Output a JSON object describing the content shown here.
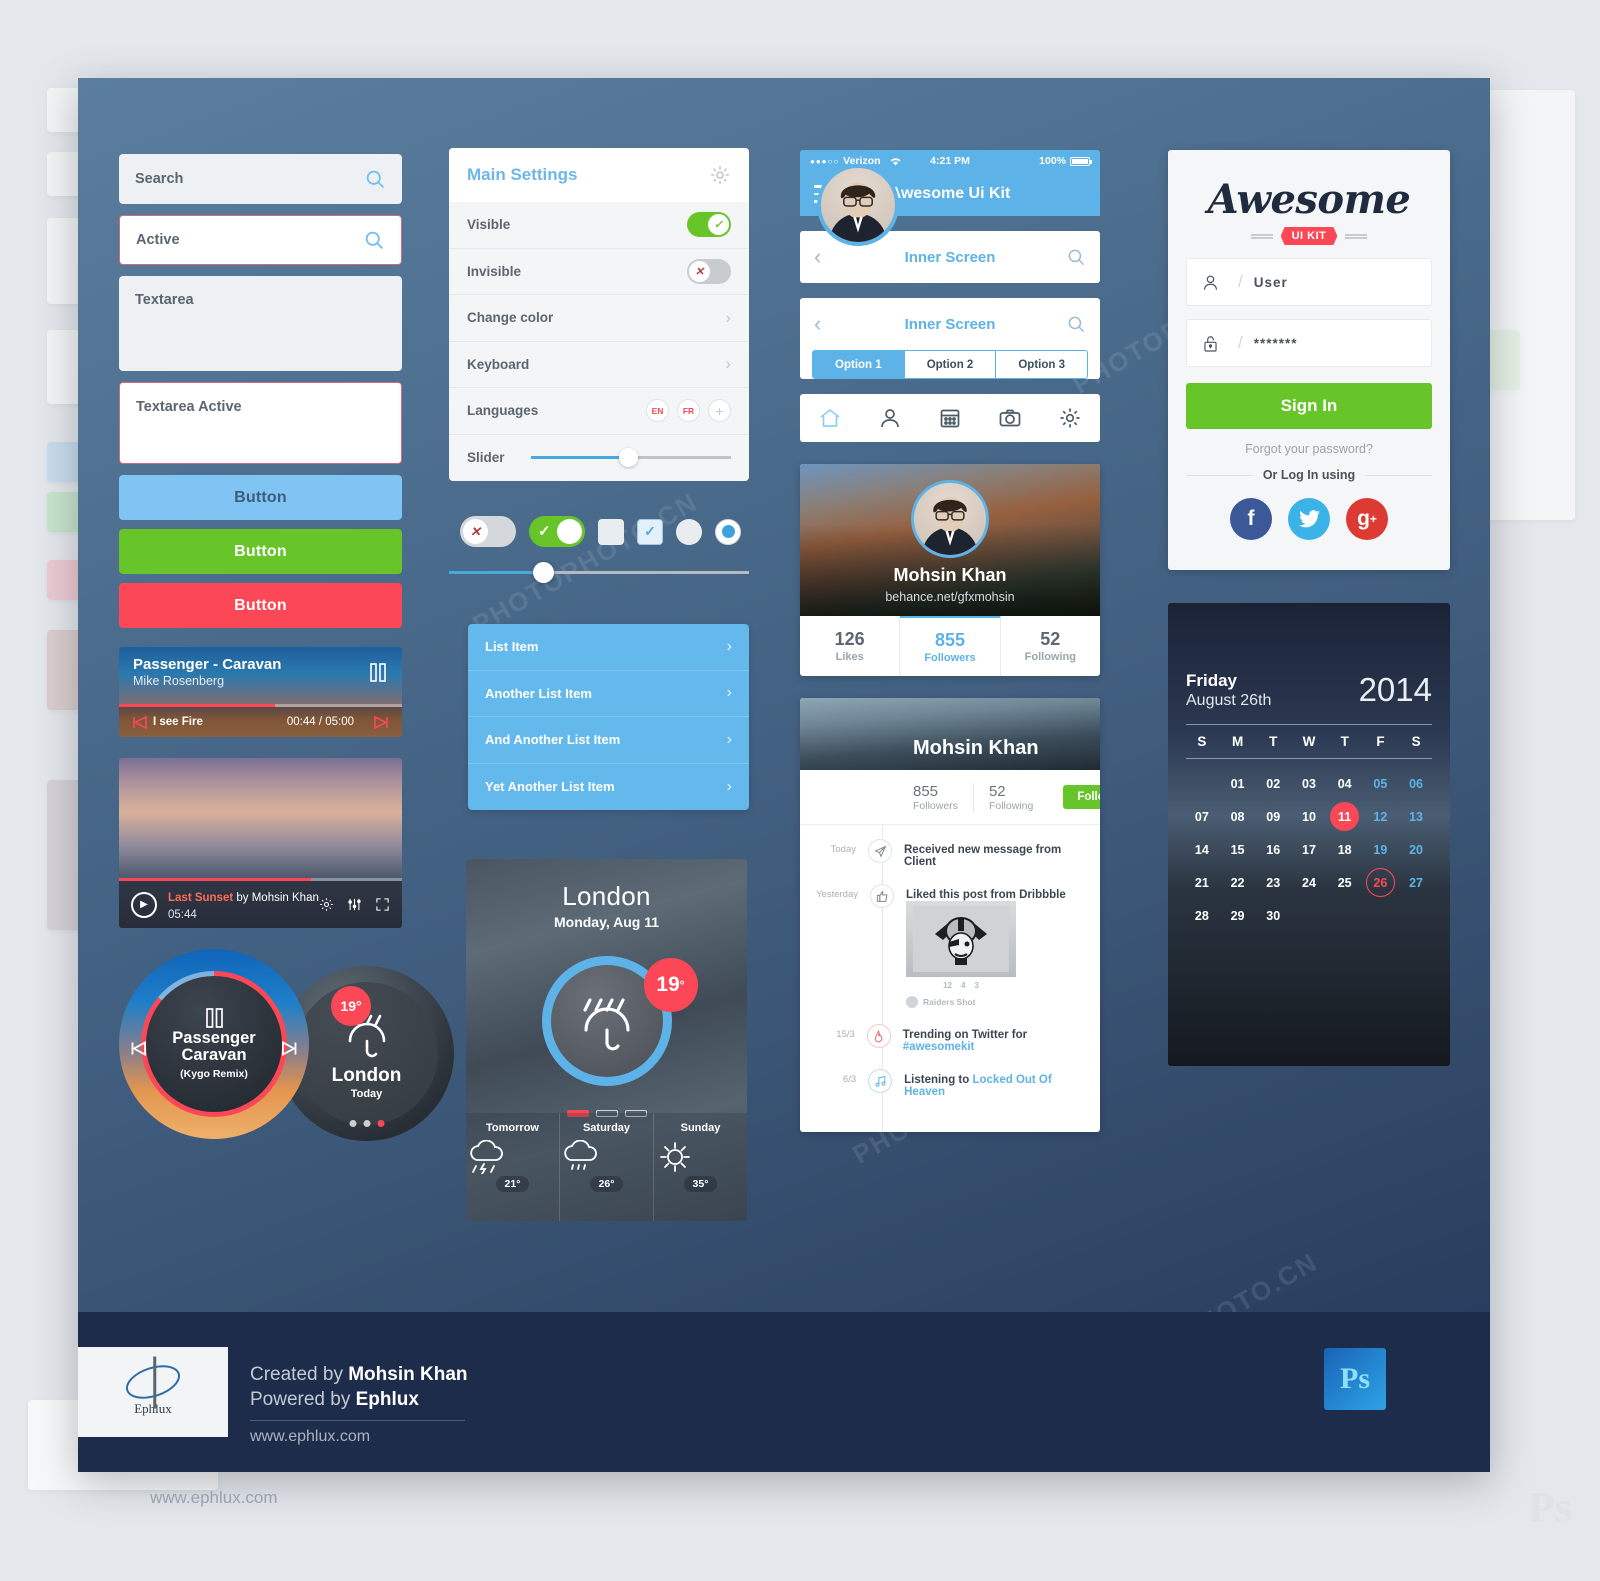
{
  "forms": {
    "search_value": "Search",
    "active_value": "Active",
    "textarea_value": "Textarea",
    "textarea_active_value": "Textarea Active",
    "button_blue": "Button",
    "button_green": "Button",
    "button_red": "Button",
    "accent_blue": "#7fc4f2",
    "accent_green": "#67c52a",
    "accent_red": "#fc4856"
  },
  "music_card": {
    "title": "Passenger - Caravan",
    "artist": "Mike Rosenberg",
    "track": "I see Fire",
    "time": "00:44 / 05:00"
  },
  "video_card": {
    "title": "Last Sunset",
    "by": "by Mohsin Khan",
    "duration": "05:44"
  },
  "circle_music": {
    "title_line1": "Passenger",
    "title_line2": "Caravan",
    "remix": "(Kygo Remix)"
  },
  "circle_weather": {
    "temp": "19°",
    "city": "London",
    "day": "Today"
  },
  "settings": {
    "title": "Main Settings",
    "rows": [
      {
        "label": "Visible",
        "control": "toggle-on"
      },
      {
        "label": "Invisible",
        "control": "toggle-off"
      },
      {
        "label": "Change color",
        "control": "chevron"
      },
      {
        "label": "Keyboard",
        "control": "chevron"
      },
      {
        "label": "Languages",
        "control": "langs"
      },
      {
        "label": "Slider",
        "control": "slider"
      }
    ],
    "lang_en": "EN",
    "lang_fr": "FR",
    "lang_add": "+"
  },
  "list": {
    "items": [
      "List Item",
      "Another List Item",
      "And Another List Item",
      "Yet Another List Item"
    ]
  },
  "weather": {
    "city": "London",
    "date": "Monday, Aug 11",
    "temp": "19",
    "degree": "°",
    "forecast": [
      {
        "day": "Tomorrow",
        "icon": "thunder-rain",
        "temp": "21°",
        "cond": "Thunder"
      },
      {
        "day": "Saturday",
        "icon": "shower",
        "temp": "26°",
        "cond": "Shower"
      },
      {
        "day": "Sunday",
        "icon": "sunny",
        "temp": "35°",
        "cond": "Sunny"
      }
    ]
  },
  "phone": {
    "carrier": "Verizon",
    "signal_dots": "●●●○○",
    "time": "4:21 PM",
    "battery": "100%",
    "app_title": "Awesome Ui Kit",
    "inner_screen_title": "Inner Screen",
    "segments": [
      "Option 1",
      "Option 2",
      "Option 3"
    ],
    "tabs": [
      "home-icon",
      "user-icon",
      "calendar-icon",
      "camera-icon",
      "gear-icon"
    ]
  },
  "profile_card": {
    "name": "Mohsin Khan",
    "url": "behance.net/gfxmohsin",
    "stats": [
      {
        "value": "126",
        "label": "Likes",
        "active": false
      },
      {
        "value": "855",
        "label": "Followers",
        "active": true
      },
      {
        "value": "52",
        "label": "Following",
        "active": false
      }
    ]
  },
  "feed_card": {
    "name": "Mohsin Khan",
    "followers_value": "855",
    "followers_label": "Followers",
    "following_value": "52",
    "following_label": "Following",
    "follow_button": "Follow",
    "events": [
      {
        "when": "Today",
        "icon": "send-icon",
        "text": "Received new message from Client",
        "link": ""
      },
      {
        "when": "Yesterday",
        "icon": "thumbs-up-icon",
        "text": "Liked this post from Dribbble",
        "link": ""
      },
      {
        "when": "15/3",
        "icon": "fire-icon",
        "text": "Trending on Twitter for ",
        "link": "#awesomekit"
      },
      {
        "when": "6/3",
        "icon": "music-note-icon",
        "text": "Listening to ",
        "link": "Locked Out Of Heaven"
      }
    ],
    "shot_stats": [
      "12",
      "4",
      "3"
    ],
    "shot_author": "Raiders Shot"
  },
  "login": {
    "logo_text": "Awesome",
    "logo_badge": "UI KIT",
    "user_value": "User",
    "password_value": "*******",
    "signin_label": "Sign In",
    "forgot_label": "Forgot your password?",
    "or_label": "Or Log In using",
    "socials": [
      "facebook-icon",
      "twitter-icon",
      "google-plus-icon"
    ]
  },
  "calendar": {
    "weekday": "Friday",
    "date": "August 26th",
    "year": "2014",
    "dow": [
      "S",
      "M",
      "T",
      "W",
      "T",
      "F",
      "S"
    ],
    "cells": [
      {
        "d": "",
        "type": "blank"
      },
      {
        "d": "01",
        "type": "day"
      },
      {
        "d": "02",
        "type": "day"
      },
      {
        "d": "03",
        "type": "day"
      },
      {
        "d": "04",
        "type": "day"
      },
      {
        "d": "05",
        "type": "weekend"
      },
      {
        "d": "06",
        "type": "weekend"
      },
      {
        "d": "07",
        "type": "day"
      },
      {
        "d": "08",
        "type": "day"
      },
      {
        "d": "09",
        "type": "day"
      },
      {
        "d": "10",
        "type": "day"
      },
      {
        "d": "11",
        "type": "today"
      },
      {
        "d": "12",
        "type": "weekend"
      },
      {
        "d": "13",
        "type": "weekend"
      },
      {
        "d": "14",
        "type": "day"
      },
      {
        "d": "15",
        "type": "day"
      },
      {
        "d": "16",
        "type": "day"
      },
      {
        "d": "17",
        "type": "day"
      },
      {
        "d": "18",
        "type": "day"
      },
      {
        "d": "19",
        "type": "weekend"
      },
      {
        "d": "20",
        "type": "weekend"
      },
      {
        "d": "21",
        "type": "day"
      },
      {
        "d": "22",
        "type": "day"
      },
      {
        "d": "23",
        "type": "day"
      },
      {
        "d": "24",
        "type": "day"
      },
      {
        "d": "25",
        "type": "day"
      },
      {
        "d": "26",
        "type": "selected"
      },
      {
        "d": "27",
        "type": "weekend"
      },
      {
        "d": "28",
        "type": "day"
      },
      {
        "d": "29",
        "type": "day"
      },
      {
        "d": "30",
        "type": "day"
      }
    ]
  },
  "footer": {
    "logo_name": "Ephlux",
    "created_prefix": "Created by ",
    "created_name": "Mohsin Khan",
    "powered_prefix": "Powered by ",
    "powered_name": "Ephlux",
    "website": "www.ephlux.com",
    "ps_badge": "Ps",
    "ghost_website": "www.ephlux.com"
  },
  "watermark": {
    "text": "PHOTOPHOTO.CN"
  }
}
